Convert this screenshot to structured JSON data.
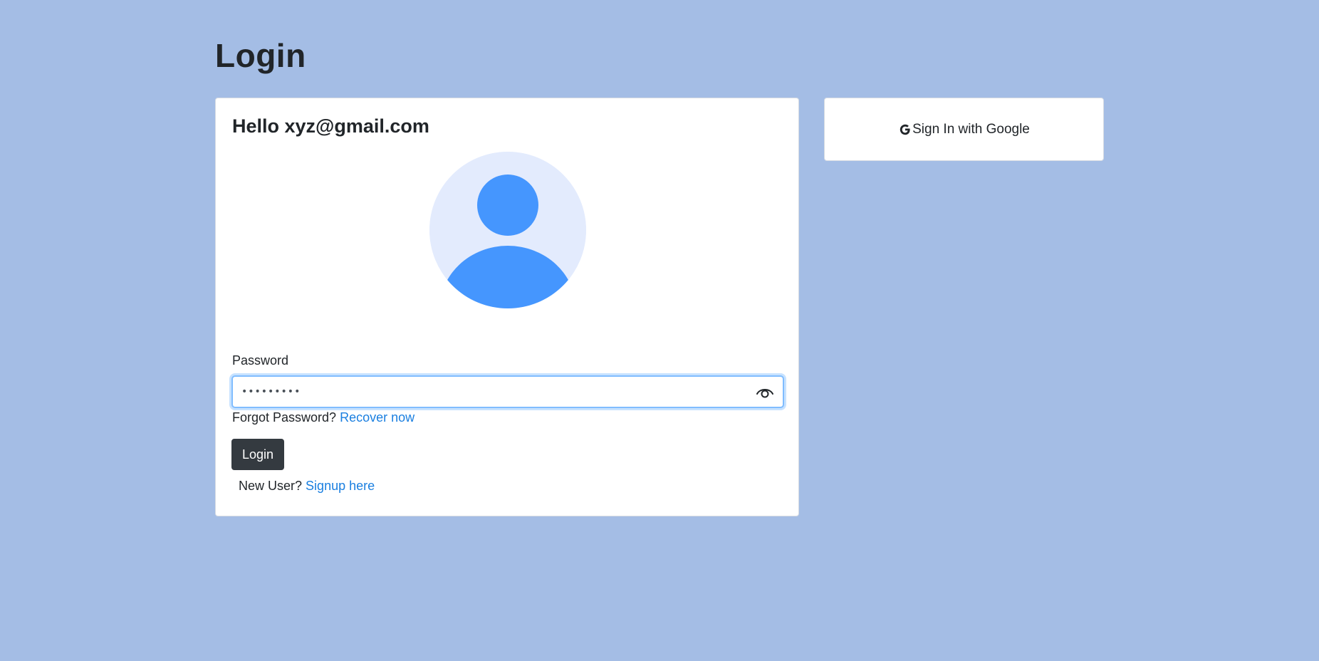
{
  "page": {
    "title": "Login",
    "background_color": "#a4bde5"
  },
  "login_card": {
    "greeting": "Hello xyz@gmail.com",
    "avatar_icon": "user-avatar-icon",
    "avatar_colors": {
      "background": "#e3ebfd",
      "figure": "#4596fe"
    },
    "password": {
      "label": "Password",
      "value": "•••••••••",
      "toggle_icon": "eye-icon"
    },
    "forgot": {
      "text": "Forgot Password?",
      "link_label": "Recover now"
    },
    "login_button_label": "Login",
    "signup": {
      "text": "New User?",
      "link_label": "Signup here"
    }
  },
  "google_card": {
    "button_label": "Sign In with Google",
    "icon": "google-g-icon"
  },
  "colors": {
    "link": "#1a7fe0",
    "primary_button": "#343a40",
    "focus_border": "#80bdff"
  }
}
